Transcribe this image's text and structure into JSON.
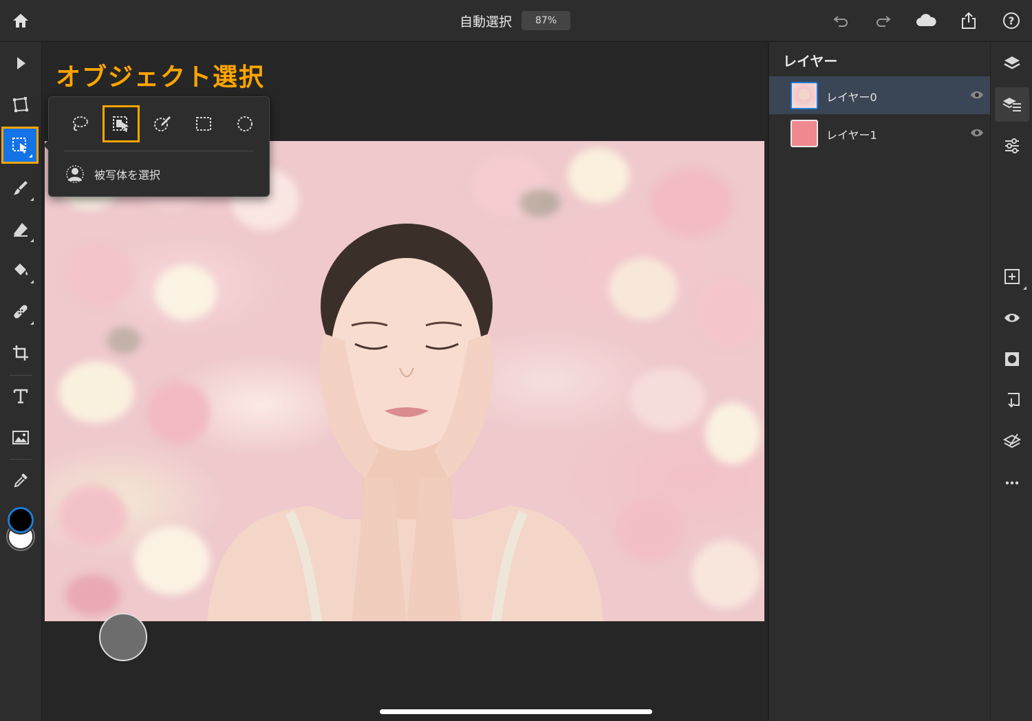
{
  "app": {
    "doc_title": "自動選択",
    "zoom": "87%"
  },
  "annotation": "オブジェクト選択",
  "popover": {
    "options": [
      "lasso-icon",
      "object-select-icon",
      "quick-select-icon",
      "rect-marquee-icon",
      "ellipse-marquee-icon"
    ],
    "subject_label": "被写体を選択"
  },
  "layers": {
    "title": "レイヤー",
    "items": [
      {
        "name": "レイヤー0",
        "selected": true
      },
      {
        "name": "レイヤー1",
        "selected": false
      }
    ]
  },
  "colors": {
    "accent": "#ffa500",
    "active_blue": "#1473e6",
    "foreground_color": "#000000",
    "background_color": "#ffffff",
    "layer1_fill": "#f08890"
  }
}
